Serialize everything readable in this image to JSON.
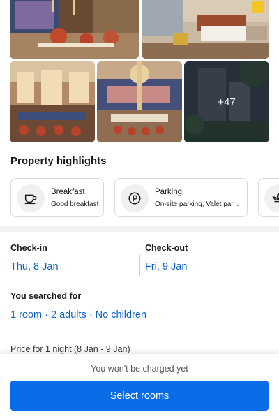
{
  "gallery": {
    "more_photos_label": "+47"
  },
  "highlights": {
    "title": "Property highlights",
    "items": [
      {
        "icon": "coffee-cup-icon",
        "title": "Breakfast",
        "subtitle": "Good breakfast"
      },
      {
        "icon": "parking-icon",
        "title": "Parking",
        "subtitle": "On-site parking, Valet par..."
      },
      {
        "icon": "lotus-icon",
        "title": "",
        "subtitle": ""
      }
    ]
  },
  "stay": {
    "checkin_label": "Check-in",
    "checkin_date": "Thu, 8 Jan",
    "checkout_label": "Check-out",
    "checkout_date": "Fri, 9 Jan",
    "searched_label": "You searched for",
    "searched_value": "1 room · 2 adults · No children",
    "price_line": "Price for 1 night (8 Jan - 9 Jan)"
  },
  "footer": {
    "note": "You won't be charged yet",
    "select_button": "Select rooms"
  },
  "colors": {
    "link": "#0b61d1",
    "primary_button": "#0a6de8"
  }
}
